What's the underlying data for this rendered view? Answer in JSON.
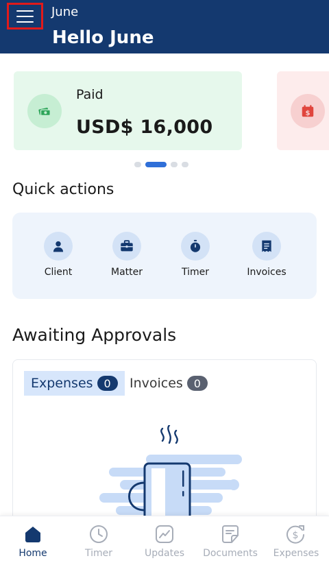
{
  "header": {
    "user_name": "June",
    "greeting": "Hello June",
    "menu_icon": "hamburger-menu-icon"
  },
  "summary_cards": [
    {
      "label": "Paid",
      "amount": "USD$ 16,000",
      "icon": "money-icon",
      "accent": "#2ea55a"
    },
    {
      "label": "",
      "amount": "",
      "icon": "calendar-dollar-icon",
      "accent": "#e0453d"
    }
  ],
  "carousel": {
    "page_count": 4,
    "active_index": 1
  },
  "quick_actions": {
    "title": "Quick actions",
    "items": [
      {
        "label": "Client",
        "icon": "person-icon"
      },
      {
        "label": "Matter",
        "icon": "briefcase-icon"
      },
      {
        "label": "Timer",
        "icon": "stopwatch-icon"
      },
      {
        "label": "Invoices",
        "icon": "invoice-icon"
      }
    ]
  },
  "approvals": {
    "title": "Awaiting Approvals",
    "tabs": [
      {
        "label": "Expenses",
        "count": "0",
        "active": true
      },
      {
        "label": "Invoices",
        "count": "0",
        "active": false
      }
    ],
    "empty_illustration": "coffee-mug-icon"
  },
  "bottom_nav": [
    {
      "label": "Home",
      "icon": "home-icon",
      "active": true
    },
    {
      "label": "Timer",
      "icon": "clock-icon",
      "active": false
    },
    {
      "label": "Updates",
      "icon": "trend-chart-icon",
      "active": false
    },
    {
      "label": "Documents",
      "icon": "document-icon",
      "active": false
    },
    {
      "label": "Expenses",
      "icon": "dollar-sign-icon",
      "active": false
    }
  ],
  "colors": {
    "primary": "#14396f",
    "paid_card_bg": "#e6f8ec",
    "due_card_bg": "#fdecec",
    "quick_actions_bg": "#eef4fc",
    "active_dot": "#2f6fd8"
  }
}
